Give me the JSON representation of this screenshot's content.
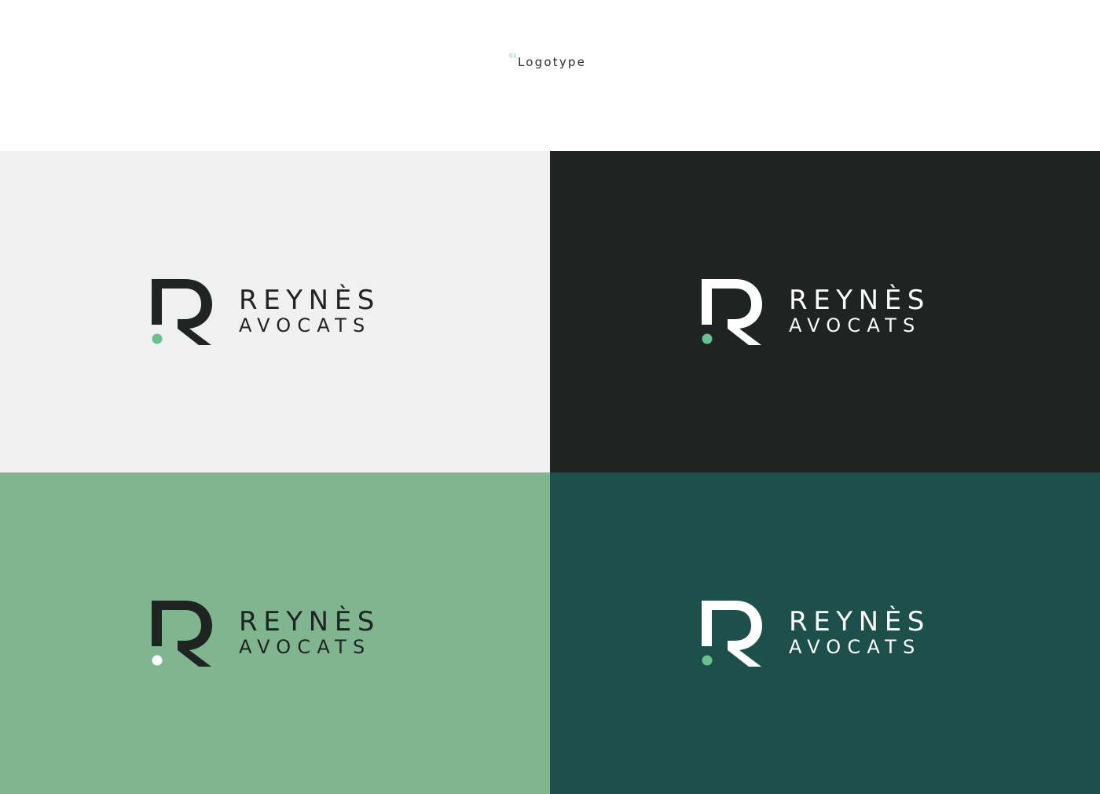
{
  "header": {
    "section_number": "01",
    "section_label": "Logotype"
  },
  "brand": {
    "line1": "REYNÈS",
    "line2": "AVOCATS",
    "logo_mark": "r-monogram-with-dot"
  },
  "variants": [
    {
      "background": "#f0f0f0",
      "ink": "#202422",
      "dot": "#6cbf90"
    },
    {
      "background": "#1f2321",
      "ink": "#ffffff",
      "dot": "#6cbf90"
    },
    {
      "background": "#80b590",
      "ink": "#1e2422",
      "dot": "#ffffff"
    },
    {
      "background": "#1d4f4b",
      "ink": "#ffffff",
      "dot": "#6cbf90"
    }
  ]
}
